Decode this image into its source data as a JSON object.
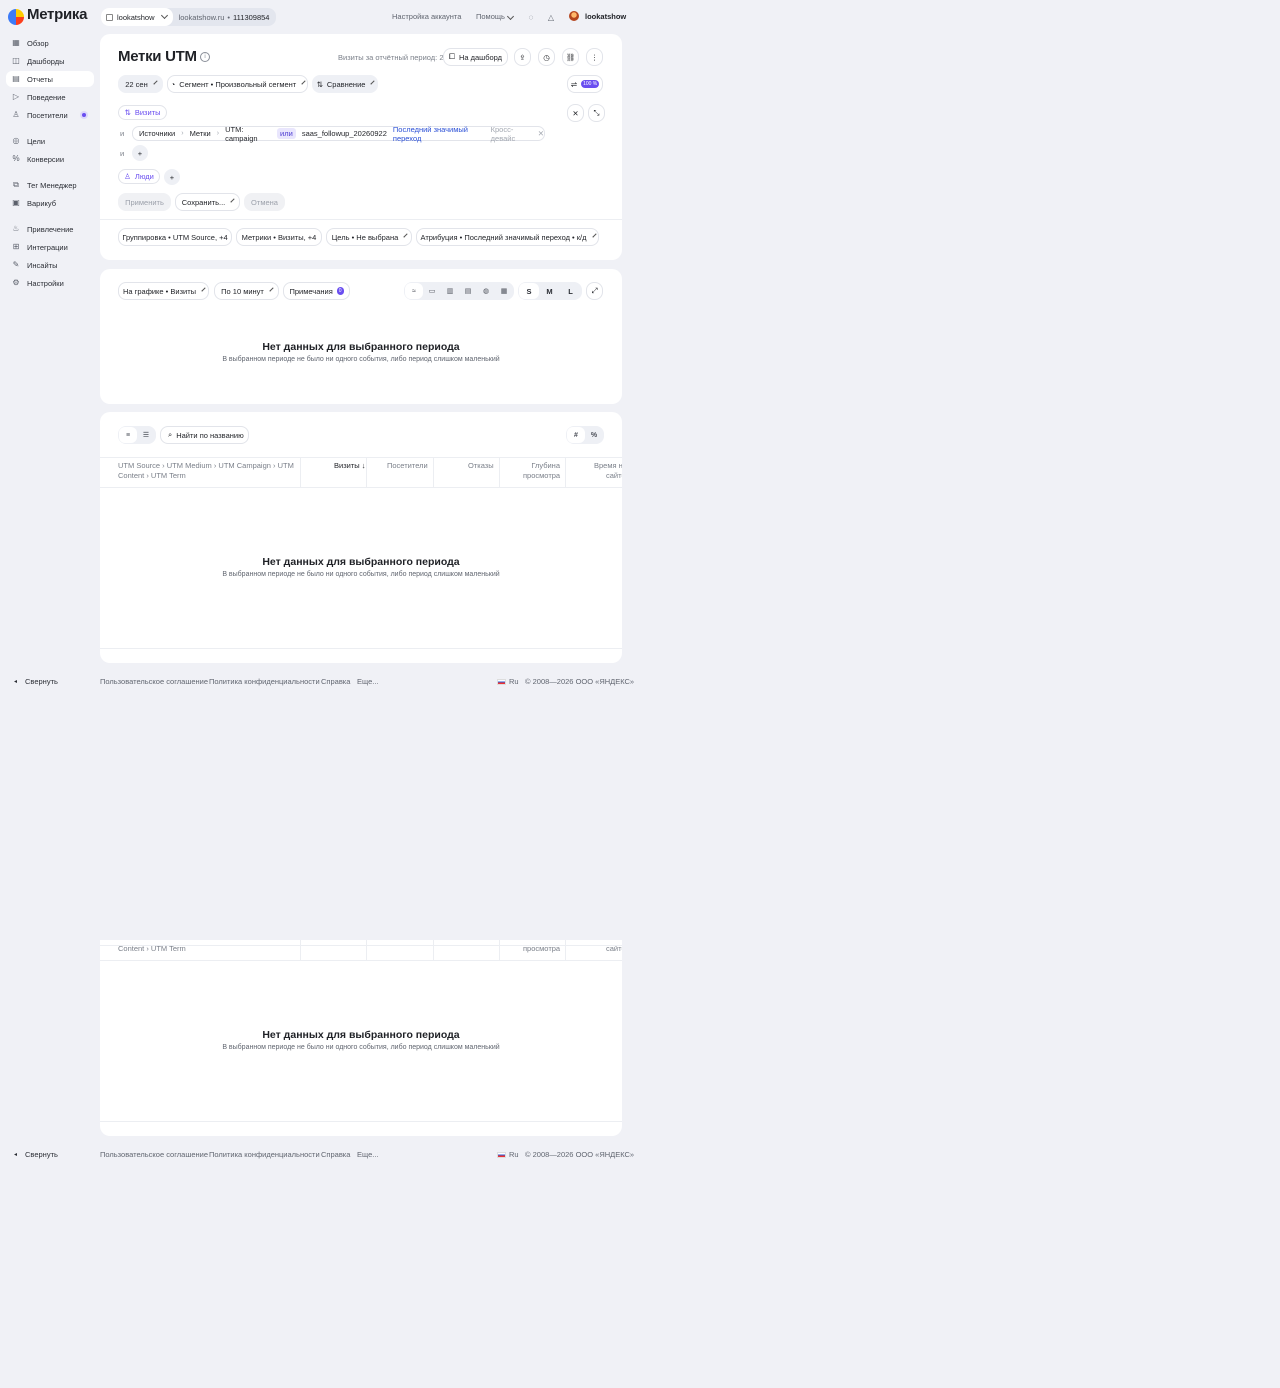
{
  "app": {
    "name": "Метрика"
  },
  "site": {
    "counter_name": "lookatshow",
    "domain": "lookatshow.ru",
    "counter_id": "111309854"
  },
  "topbar": {
    "account_settings": "Настройка аккаунта",
    "help": "Помощь",
    "username": "lookatshow"
  },
  "sidebar": {
    "items": [
      {
        "label": "Обзор",
        "icon": "grid-icon"
      },
      {
        "label": "Дашборды",
        "icon": "dashboards-icon"
      },
      {
        "label": "Отчеты",
        "icon": "reports-icon",
        "active": true
      },
      {
        "label": "Поведение",
        "icon": "play-icon"
      },
      {
        "label": "Посетители",
        "icon": "user-icon"
      },
      {
        "label": "Цели",
        "icon": "target-icon"
      },
      {
        "label": "Конверсии",
        "icon": "percent-icon"
      },
      {
        "label": "Тег Менеджер",
        "icon": "tag-manager-icon"
      },
      {
        "label": "Варикуб",
        "icon": "varicube-icon"
      },
      {
        "label": "Привлечение",
        "icon": "fire-icon"
      },
      {
        "label": "Интеграции",
        "icon": "integrations-icon"
      },
      {
        "label": "Инсайты",
        "icon": "insights-icon"
      },
      {
        "label": "Настройки",
        "icon": "gear-icon"
      }
    ],
    "collapse": "Свернуть"
  },
  "report": {
    "title": "Метки UTM",
    "visits_for_period": "Визиты за отчётный период: 2",
    "to_dashboard": "На дашборд",
    "date": "22 сен",
    "segment": "Сегмент • Произвольный сегмент",
    "compare": "Сравнение",
    "accuracy_badge": "100 %"
  },
  "filter": {
    "visits_chip": "Визиты",
    "and": "и",
    "path": [
      "Источники",
      "Метки",
      "UTM: campaign"
    ],
    "or": "или",
    "value": "saas_followup_20260922",
    "attribution": "Последний значимый переход",
    "crossdevice": "Кросс-девайс",
    "people_chip": "Люди",
    "apply": "Применить",
    "save": "Сохранить...",
    "cancel": "Отмена"
  },
  "settings_row": {
    "grouping": "Группировка • UTM Source, +4",
    "metrics": "Метрики • Визиты, +4",
    "goal": "Цель • Не выбрана",
    "attribution": "Атрибуция • Последний значимый переход • к/д"
  },
  "chart_panel": {
    "on_chart": "На графике • Визиты",
    "interval": "По 10 минут",
    "notes": "Примечания",
    "notes_count": "0",
    "sizes": [
      "S",
      "M",
      "L"
    ],
    "empty_title": "Нет данных для выбранного периода",
    "empty_sub": "В выбранном периоде не было ни одного события, либо период слишком маленький"
  },
  "table_panel": {
    "search_placeholder": "Найти по названию",
    "hash": "#",
    "percent": "%",
    "col_dims_1": "UTM Source › UTM Medium › UTM Campaign › UTM",
    "col_dims_2": "Content › UTM Term",
    "col_visits": "Визиты",
    "col_visitors": "Посетители",
    "col_bounces": "Отказы",
    "col_depth_1": "Глубина",
    "col_depth_2": "просмотра",
    "col_time_1": "Время на",
    "col_time_2": "сайте",
    "empty_title": "Нет данных для выбранного периода",
    "empty_sub": "В выбранном периоде не было ни одного события, либо период слишком маленький"
  },
  "footer": {
    "terms": "Пользовательское соглашение",
    "privacy": "Политика конфиденциальности",
    "help": "Справка",
    "more": "Еще...",
    "lang": "Ru",
    "copyright": "© 2008—2026 ООО «ЯНДЕКС»"
  }
}
